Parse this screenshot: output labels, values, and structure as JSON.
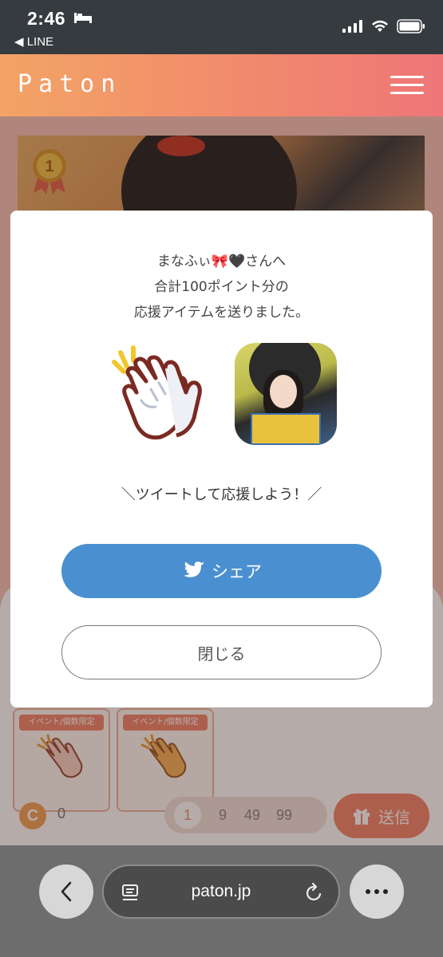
{
  "status_bar": {
    "time": "2:46",
    "back_app": "◀ LINE"
  },
  "header": {
    "logo": "Paton"
  },
  "items": [
    {
      "tag": "イベント/個数限定"
    },
    {
      "tag": "イベント/個数限定"
    }
  ],
  "coins": {
    "icon": "C",
    "value": "0"
  },
  "quantity_options": [
    "1",
    "9",
    "49",
    "99"
  ],
  "send_label": "送信",
  "modal": {
    "line1": "まなふぃ🎀🖤さんへ",
    "line2": "合計100ポイント分の",
    "line3": "応援アイテムを送りました。",
    "tweet_prompt": "＼ツイートして応援しよう！／",
    "share_label": "シェア",
    "close_label": "閉じる"
  },
  "browser": {
    "url": "paton.jp"
  },
  "colors": {
    "share_blue": "#4a90d0",
    "brand_orange": "#f18a6c"
  }
}
